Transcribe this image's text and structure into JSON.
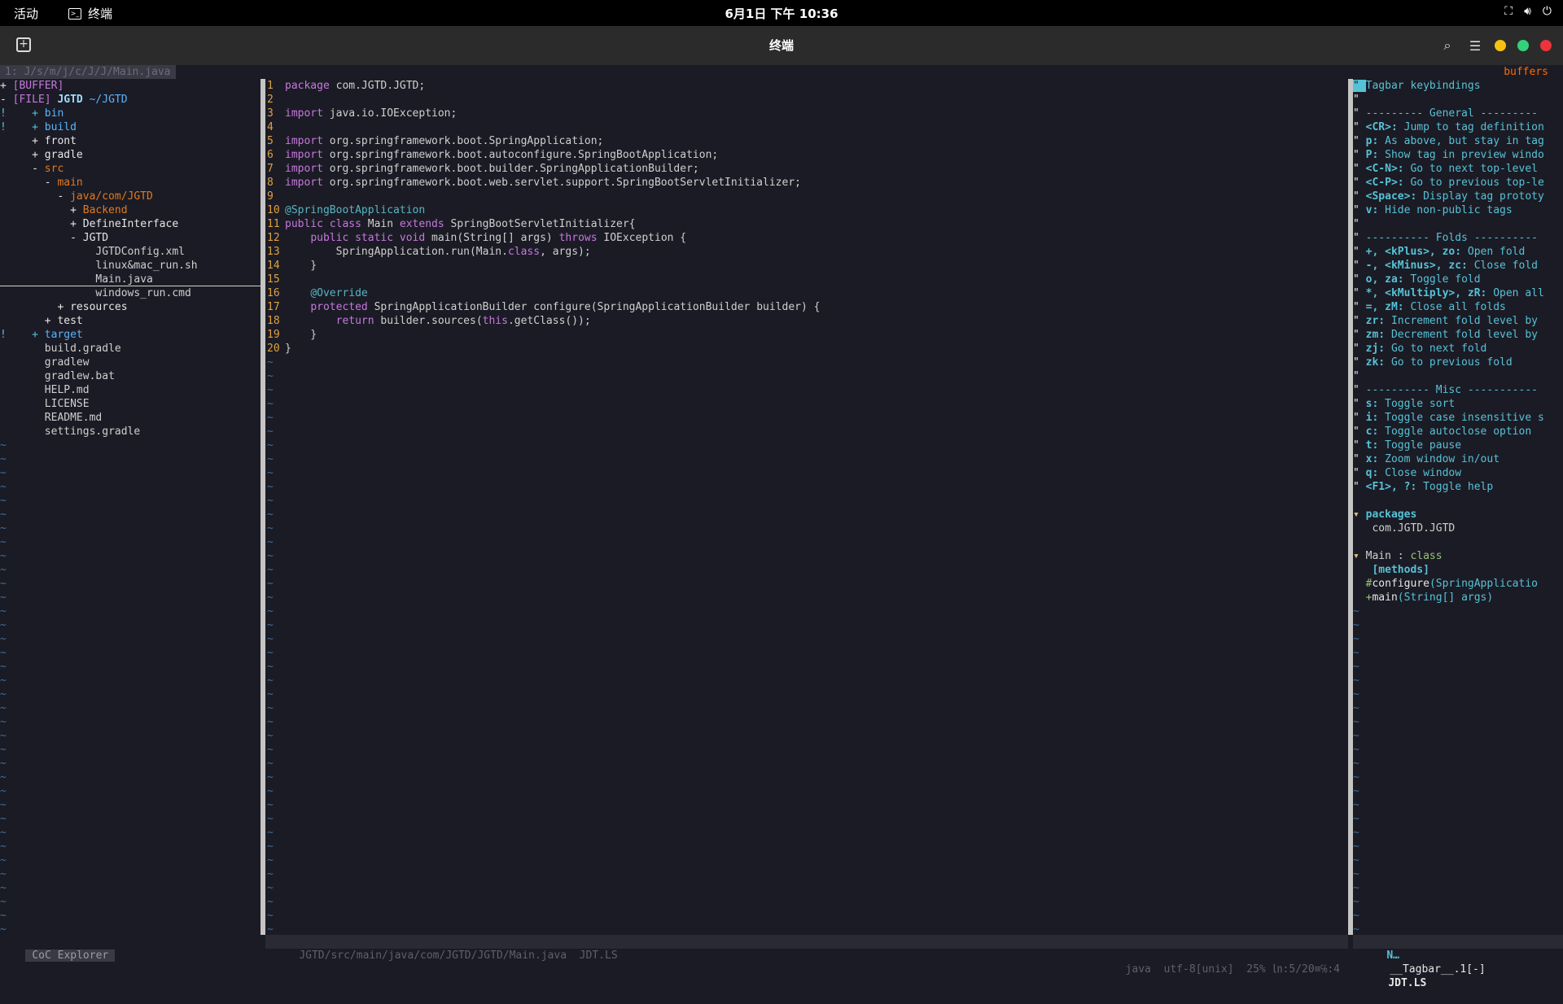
{
  "topbar": {
    "activities": "活动",
    "app_name": "终端",
    "clock": "6月1日 下午 10:36"
  },
  "window": {
    "title": "终端"
  },
  "tabline": {
    "buffer_path": "1: J/s/m/j/c/J/J/Main.java",
    "buffers_label": "buffers"
  },
  "explorer": {
    "rows": [
      {
        "prefix": "+ ",
        "text": "[BUFFER]",
        "color": "mag"
      },
      {
        "prefix": "- ",
        "text": "[FILE] ",
        "color": "mag",
        "extra": "JGTD",
        "extra2": " ~/JGTD"
      },
      {
        "prefix": "!    + ",
        "text": "bin",
        "color": "blue"
      },
      {
        "prefix": "!    + ",
        "text": "build",
        "color": "blue"
      },
      {
        "prefix": "     + ",
        "text": "front",
        "color": "white"
      },
      {
        "prefix": "     + ",
        "text": "gradle",
        "color": "white"
      },
      {
        "prefix": "     - ",
        "text": "src",
        "color": "orange"
      },
      {
        "prefix": "       - ",
        "text": "main",
        "color": "orange"
      },
      {
        "prefix": "         - ",
        "text": "java/com/JGTD",
        "color": "orange"
      },
      {
        "prefix": "           + ",
        "text": "Backend",
        "color": "orange"
      },
      {
        "prefix": "           + ",
        "text": "DefineInterface",
        "color": "white"
      },
      {
        "prefix": "           - ",
        "text": "JGTD",
        "color": "white"
      },
      {
        "prefix": "               ",
        "text": "JGTDConfig.xml",
        "color": "grey"
      },
      {
        "prefix": "               ",
        "text": "linux&mac_run.sh",
        "color": "grey"
      },
      {
        "prefix": "               ",
        "text": "Main.java",
        "color": "grey",
        "cursor": true
      },
      {
        "prefix": "               ",
        "text": "windows_run.cmd",
        "color": "grey"
      },
      {
        "prefix": "         + ",
        "text": "resources",
        "color": "white"
      },
      {
        "prefix": "       + ",
        "text": "test",
        "color": "white"
      },
      {
        "prefix": "!    + ",
        "text": "target",
        "color": "blue"
      },
      {
        "prefix": "       ",
        "text": "build.gradle",
        "color": "grey"
      },
      {
        "prefix": "       ",
        "text": "gradlew",
        "color": "grey"
      },
      {
        "prefix": "       ",
        "text": "gradlew.bat",
        "color": "grey"
      },
      {
        "prefix": "       ",
        "text": "HELP.md",
        "color": "grey"
      },
      {
        "prefix": "       ",
        "text": "LICENSE",
        "color": "grey"
      },
      {
        "prefix": "       ",
        "text": "README.md",
        "color": "grey"
      },
      {
        "prefix": "       ",
        "text": "settings.gradle",
        "color": "grey"
      }
    ],
    "status": "CoC Explorer"
  },
  "editor": {
    "lines": [
      [
        [
          "kw",
          "package"
        ],
        [
          "t",
          " com.JGTD.JGTD;"
        ]
      ],
      [],
      [
        [
          "kw",
          "import"
        ],
        [
          "t",
          " java.io.IOException;"
        ]
      ],
      [],
      [
        [
          "kw",
          "import"
        ],
        [
          "t",
          " org.springframework.boot.SpringApplication;"
        ]
      ],
      [
        [
          "kw",
          "import"
        ],
        [
          "t",
          " org.springframework.boot.autoconfigure.SpringBootApplication;"
        ]
      ],
      [
        [
          "kw",
          "import"
        ],
        [
          "t",
          " org.springframework.boot.builder.SpringApplicationBuilder;"
        ]
      ],
      [
        [
          "kw",
          "import"
        ],
        [
          "t",
          " org.springframework.boot.web.servlet.support.SpringBootServletInitializer;"
        ]
      ],
      [],
      [
        [
          "ann",
          "@SpringBootApplication"
        ]
      ],
      [
        [
          "kw",
          "public"
        ],
        [
          "t",
          " "
        ],
        [
          "kw",
          "class"
        ],
        [
          "t",
          " Main "
        ],
        [
          "kw",
          "extends"
        ],
        [
          "t",
          " SpringBootServletInitializer{"
        ]
      ],
      [
        [
          "t",
          "    "
        ],
        [
          "kw",
          "public"
        ],
        [
          "t",
          " "
        ],
        [
          "kw",
          "static"
        ],
        [
          "t",
          " "
        ],
        [
          "kw",
          "void"
        ],
        [
          "t",
          " main(String[] args) "
        ],
        [
          "kw",
          "throws"
        ],
        [
          "t",
          " IOException {"
        ]
      ],
      [
        [
          "t",
          "        SpringApplication.run(Main."
        ],
        [
          "kw",
          "class"
        ],
        [
          "t",
          ", args);"
        ]
      ],
      [
        [
          "t",
          "    }"
        ]
      ],
      [],
      [
        [
          "t",
          "    "
        ],
        [
          "ann",
          "@Override"
        ]
      ],
      [
        [
          "t",
          "    "
        ],
        [
          "kw",
          "protected"
        ],
        [
          "t",
          " SpringApplicationBuilder configure(SpringApplicationBuilder builder) {"
        ]
      ],
      [
        [
          "t",
          "        "
        ],
        [
          "kw",
          "return"
        ],
        [
          "t",
          " builder.sources("
        ],
        [
          "kw",
          "this"
        ],
        [
          "t",
          ".getClass());"
        ]
      ],
      [
        [
          "t",
          "    }"
        ]
      ],
      [
        [
          "t",
          "}"
        ]
      ]
    ],
    "status_left": "JGTD/src/main/java/com/JGTD/JGTD/Main.java  JDT.LS",
    "status_right": "java  utf-8[unix]  25% ㏑:5/20≡℅:4"
  },
  "tagbar": {
    "help": [
      {
        "q": "\" ",
        "key": "",
        "desc": "Tagbar keybindings"
      },
      {
        "q": "\"",
        "key": "",
        "desc": ""
      },
      {
        "q": "\" ",
        "key": "",
        "desc": "--------- General ---------"
      },
      {
        "q": "\" ",
        "key": "<CR>:",
        "desc": " Jump to tag definition"
      },
      {
        "q": "\" ",
        "key": "p:",
        "desc": " As above, but stay in tag"
      },
      {
        "q": "\" ",
        "key": "P:",
        "desc": " Show tag in preview windo"
      },
      {
        "q": "\" ",
        "key": "<C-N>:",
        "desc": " Go to next top-level"
      },
      {
        "q": "\" ",
        "key": "<C-P>:",
        "desc": " Go to previous top-le"
      },
      {
        "q": "\" ",
        "key": "<Space>:",
        "desc": " Display tag prototy"
      },
      {
        "q": "\" ",
        "key": "v:",
        "desc": " Hide non-public tags"
      },
      {
        "q": "\"",
        "key": "",
        "desc": ""
      },
      {
        "q": "\" ",
        "key": "",
        "desc": "---------- Folds ----------"
      },
      {
        "q": "\" ",
        "key": "+, <kPlus>, zo:",
        "desc": " Open fold"
      },
      {
        "q": "\" ",
        "key": "-, <kMinus>, zc:",
        "desc": " Close fold"
      },
      {
        "q": "\" ",
        "key": "o, za:",
        "desc": " Toggle fold"
      },
      {
        "q": "\" ",
        "key": "*, <kMultiply>, zR:",
        "desc": " Open all"
      },
      {
        "q": "\" ",
        "key": "=, zM:",
        "desc": " Close all folds"
      },
      {
        "q": "\" ",
        "key": "zr:",
        "desc": " Increment fold level by"
      },
      {
        "q": "\" ",
        "key": "zm:",
        "desc": " Decrement fold level by"
      },
      {
        "q": "\" ",
        "key": "zj:",
        "desc": " Go to next fold"
      },
      {
        "q": "\" ",
        "key": "zk:",
        "desc": " Go to previous fold"
      },
      {
        "q": "\"",
        "key": "",
        "desc": ""
      },
      {
        "q": "\" ",
        "key": "",
        "desc": "---------- Misc -----------"
      },
      {
        "q": "\" ",
        "key": "s:",
        "desc": " Toggle sort"
      },
      {
        "q": "\" ",
        "key": "i:",
        "desc": " Toggle case insensitive s"
      },
      {
        "q": "\" ",
        "key": "c:",
        "desc": " Toggle autoclose option"
      },
      {
        "q": "\" ",
        "key": "t:",
        "desc": " Toggle pause"
      },
      {
        "q": "\" ",
        "key": "x:",
        "desc": " Zoom window in/out"
      },
      {
        "q": "\" ",
        "key": "q:",
        "desc": " Close window"
      },
      {
        "q": "\" ",
        "key": "<F1>, ?:",
        "desc": " Toggle help"
      }
    ],
    "packages_header": "packages",
    "package_name": "com.JGTD.JGTD",
    "class_header": "Main : class",
    "methods_header": "[methods]",
    "methods": [
      {
        "vis": "#",
        "name": "configure",
        "sig": "(SpringApplicatio"
      },
      {
        "vis": "+",
        "name": "main",
        "sig": "(String[] args)"
      }
    ],
    "status_mode": "N…",
    "status_name": "__Tagbar__.1[-]",
    "status_ls": "JDT.LS"
  },
  "colors": {
    "kw": "#c678dd",
    "type": "#56c2d6",
    "accent": "#ff6a00",
    "tagbar_key": "#56c2d6"
  }
}
